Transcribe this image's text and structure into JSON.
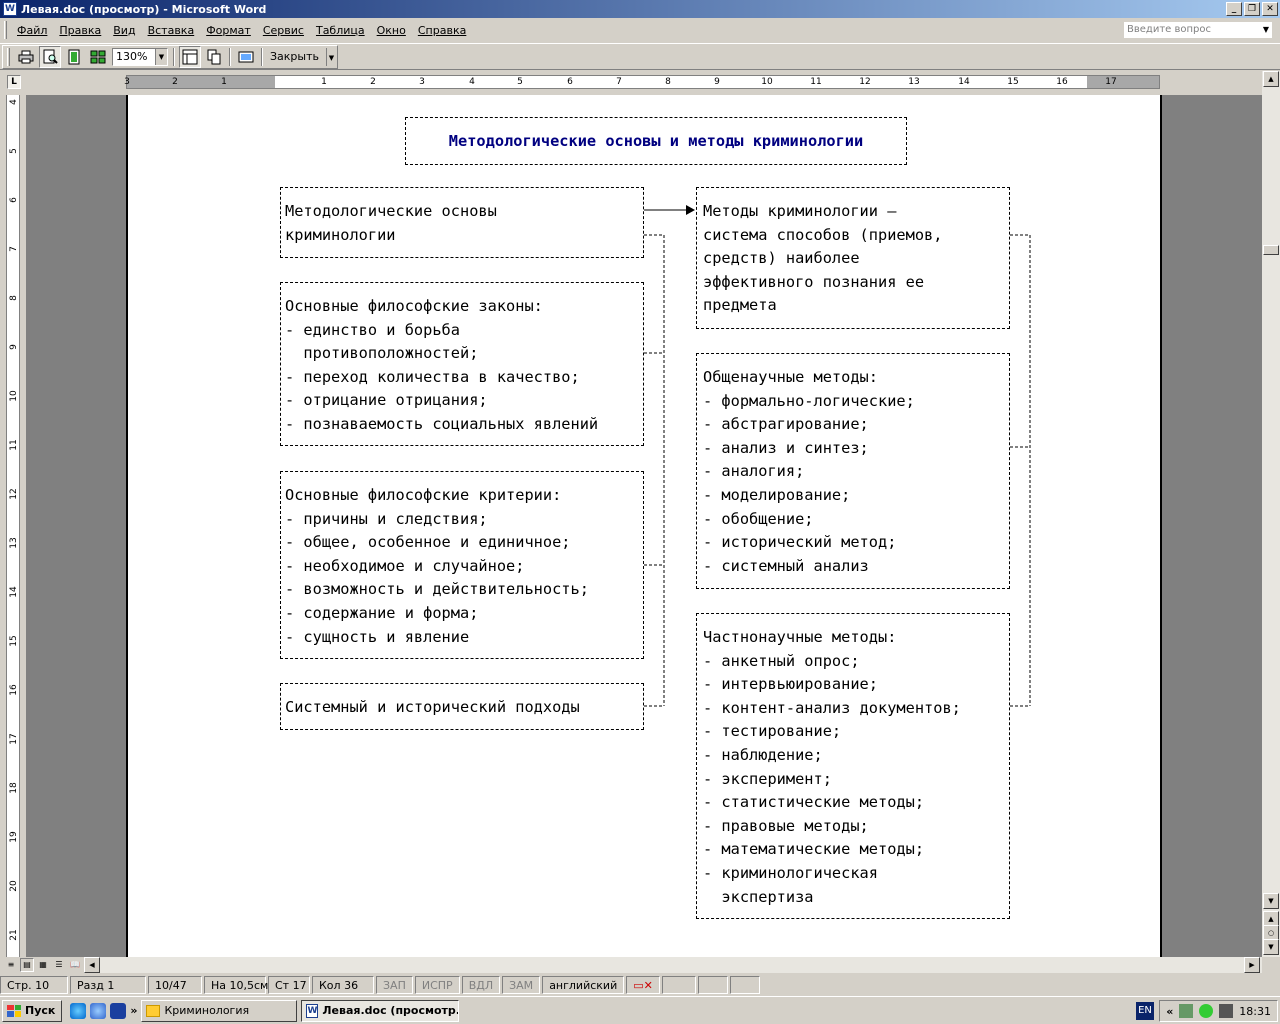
{
  "window": {
    "title": "Левая.doc (просмотр) - Microsoft Word",
    "app_icon_glyph": "W",
    "controls": [
      "minimize",
      "restore",
      "close"
    ]
  },
  "menu": {
    "items": [
      "Файл",
      "Правка",
      "Вид",
      "Вставка",
      "Формат",
      "Сервис",
      "Таблица",
      "Окно",
      "Справка"
    ],
    "help_placeholder": "Введите вопрос"
  },
  "toolbar": {
    "zoom": "130%",
    "close_label": "Закрыть"
  },
  "ruler": {
    "tab_selector": "L",
    "h_numbers": [
      "3",
      "2",
      "1",
      "1",
      "2",
      "3",
      "4",
      "5",
      "6",
      "7",
      "8",
      "9",
      "10",
      "11",
      "12",
      "13",
      "14",
      "15",
      "16",
      "17"
    ],
    "v_numbers": [
      "4",
      "5",
      "6",
      "7",
      "8",
      "9",
      "10",
      "11",
      "12",
      "13",
      "14",
      "15",
      "16",
      "17",
      "18",
      "19",
      "20",
      "21"
    ]
  },
  "document": {
    "title": "Методологические основы и методы криминологии",
    "left_boxes": [
      [
        "Методологические основы",
        "криминологии"
      ],
      [
        "Основные философские законы:",
        "- единство и борьба",
        "  противоположностей;",
        "- переход количества в качество;",
        "- отрицание отрицания;",
        "- познаваемость социальных явлений"
      ],
      [
        "Основные философские критерии:",
        "- причины и следствия;",
        "- общее, особенное и единичное;",
        "- необходимое и случайное;",
        "- возможность и действительность;",
        "- содержание и форма;",
        "- сущность и явление"
      ],
      [
        "Системный и исторический подходы"
      ]
    ],
    "right_boxes": [
      [
        "Методы криминологии –",
        "система способов (приемов,",
        "средств) наиболее",
        "эффективного познания ее",
        "предмета"
      ],
      [
        "Общенаучные методы:",
        "- формально-логические;",
        "- абстрагирование;",
        "- анализ и синтез;",
        "- аналогия;",
        "- моделирование;",
        "- обобщение;",
        "- исторический метод;",
        "- системный анализ"
      ],
      [
        "Частнонаучные методы:",
        "- анкетный опрос;",
        "- интервьюирование;",
        "- контент-анализ документов;",
        "- тестирование;",
        "- наблюдение;",
        "- эксперимент;",
        "- статистические методы;",
        "- правовые методы;",
        "- математические методы;",
        "- криминологическая",
        "  экспертиза"
      ]
    ]
  },
  "status": {
    "page": "Стр. 10",
    "section": "Разд 1",
    "pages": "10/47",
    "at": "На 10,5см",
    "line": "Ст 17",
    "col": "Кол 36",
    "rec": "ЗАП",
    "trk": "ИСПР",
    "ext": "ВДЛ",
    "ovr": "ЗАМ",
    "lang": "английский"
  },
  "taskbar": {
    "start": "Пуск",
    "tasks": [
      "Криминология",
      "Левая.doc (просмотр..."
    ],
    "lang": "EN",
    "clock": "18:31"
  },
  "colors": {
    "title_blue": "#000080",
    "titlebar_start": "#0a246a",
    "titlebar_end": "#a6caf0"
  }
}
